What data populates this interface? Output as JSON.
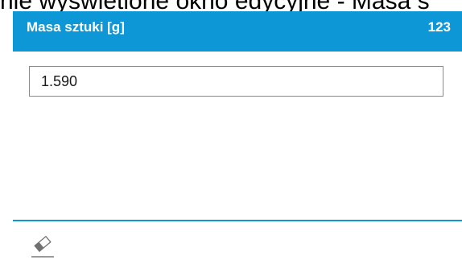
{
  "caption": "nie wyświetlone okno edycyjne - Masa s",
  "dialog": {
    "title": "Masa sztuki [g]",
    "code": "123",
    "value": "1.590",
    "accent_color": "#0e97d6"
  },
  "footer": {
    "clear_icon": "eraser-icon"
  }
}
